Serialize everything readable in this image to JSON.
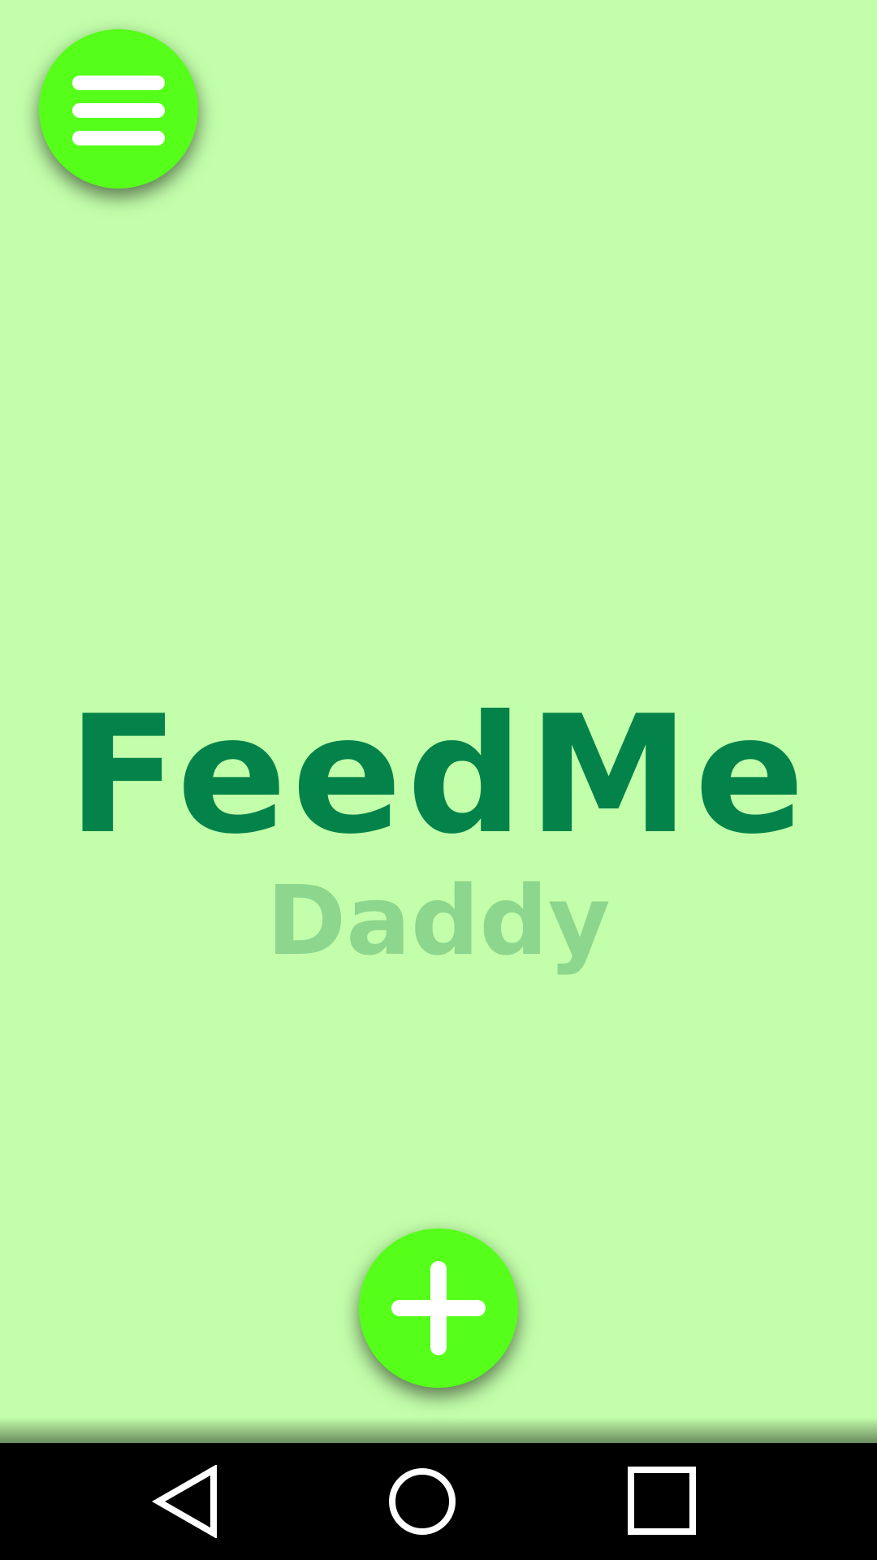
{
  "app": {
    "title": "FeedMe",
    "subtitle": "Daddy"
  },
  "colors": {
    "background": "#c3ffab",
    "fab": "#56ff1a",
    "title": "#03834a",
    "subtitle": "#8cd68d",
    "navbar": "#000000",
    "icon": "#ffffff"
  },
  "icons": {
    "menu": "hamburger-menu-icon",
    "add": "plus-icon",
    "back": "triangle-back-icon",
    "home": "circle-home-icon",
    "recents": "square-recents-icon"
  }
}
